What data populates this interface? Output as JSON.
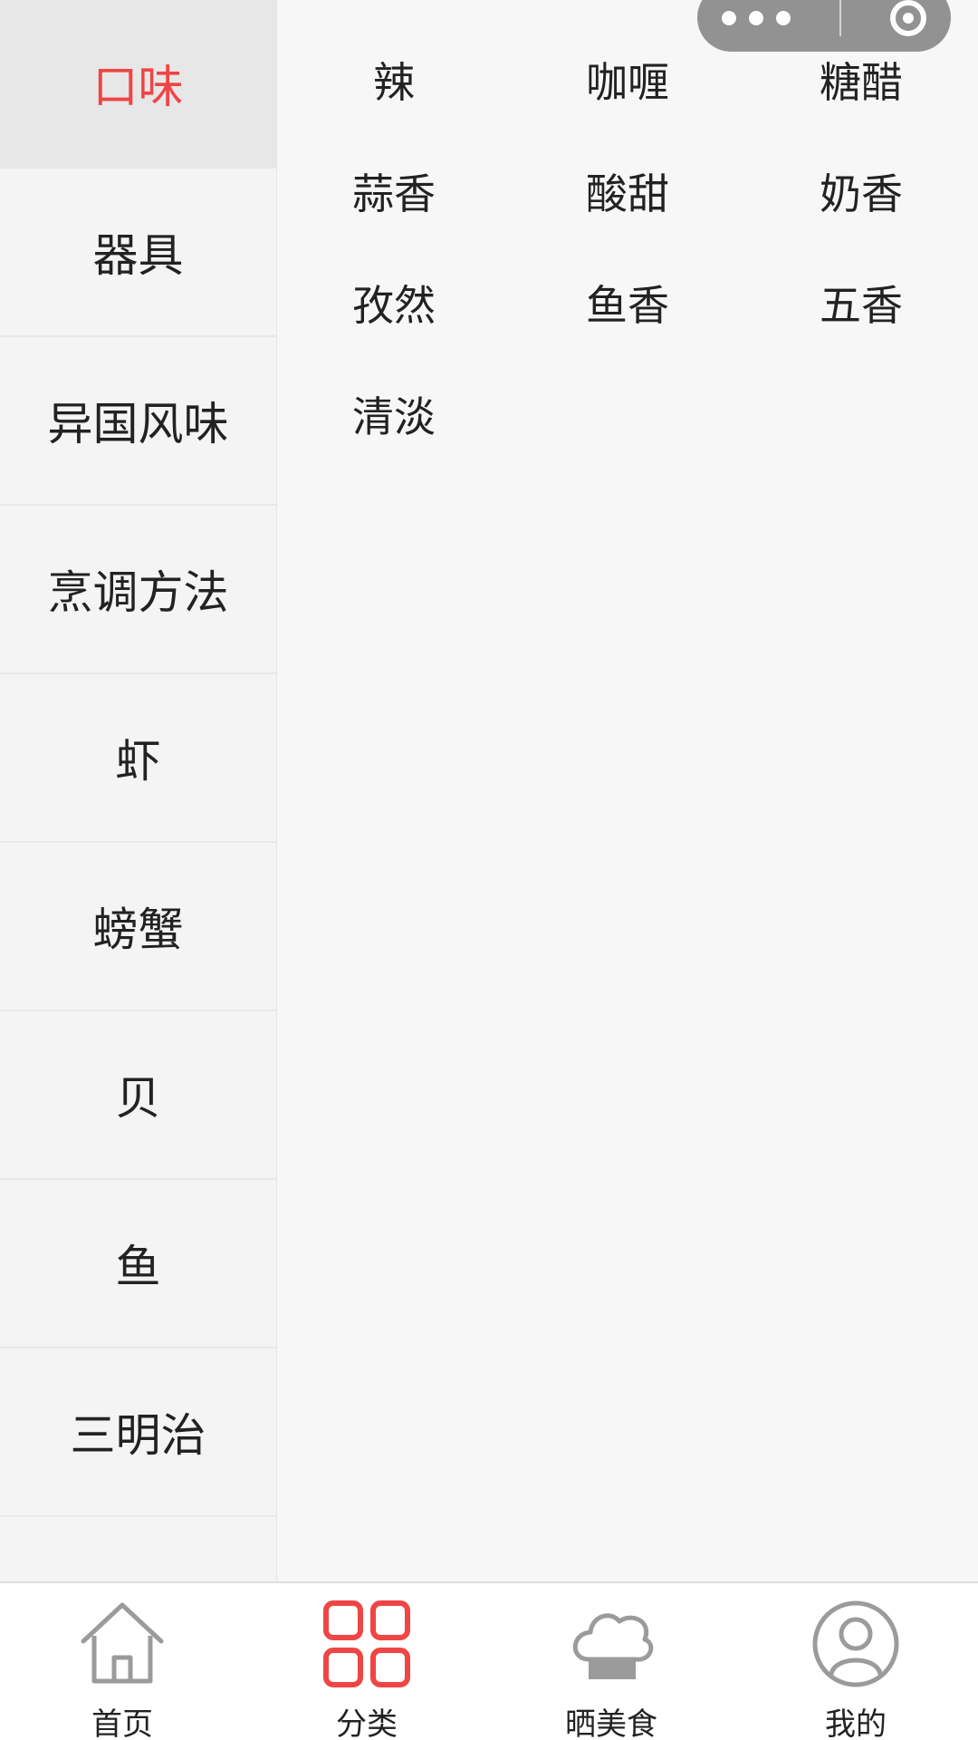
{
  "sidebar": {
    "items": [
      {
        "label": "口味",
        "active": true
      },
      {
        "label": "器具"
      },
      {
        "label": "异国风味"
      },
      {
        "label": "烹调方法"
      },
      {
        "label": "虾"
      },
      {
        "label": "螃蟹"
      },
      {
        "label": "贝"
      },
      {
        "label": "鱼"
      },
      {
        "label": "三明治"
      }
    ]
  },
  "content": {
    "tags": [
      "辣",
      "咖喱",
      "糖醋",
      "蒜香",
      "酸甜",
      "奶香",
      "孜然",
      "鱼香",
      "五香",
      "清淡"
    ]
  },
  "tabbar": {
    "items": [
      {
        "label": "首页",
        "icon": "home-icon"
      },
      {
        "label": "分类",
        "icon": "category-icon",
        "active": true
      },
      {
        "label": "晒美食",
        "icon": "chef-hat-icon"
      },
      {
        "label": "我的",
        "icon": "user-icon"
      }
    ]
  },
  "colors": {
    "accent": "#f04545",
    "sidebar_active_bg": "#e7e7e7",
    "capsule_bg": "#8a8a8a",
    "icon_gray": "#9b9b9b"
  }
}
